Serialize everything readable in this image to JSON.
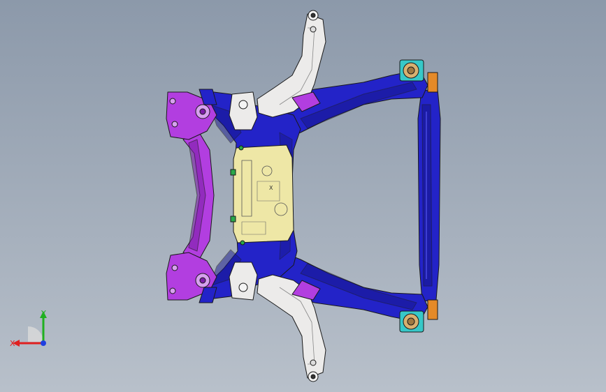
{
  "viewport": {
    "background_top": "#8c99aa",
    "background_bottom": "#b8c0ca"
  },
  "model": {
    "colors": {
      "frame_blue": "#2323c8",
      "frame_dark": "#16168a",
      "bracket_purple": "#b23ee0",
      "bracket_purple_dark": "#7d1fa8",
      "arm_white": "#ecebea",
      "plate_yellow": "#eee7a6",
      "bushing_cyan": "#37c8c8",
      "bushing_orange": "#e58a28",
      "bushing_tan": "#d8b070",
      "mount_green": "#2aa84a",
      "edge": "#1a1a1a"
    },
    "plate_marker": "X"
  },
  "triad": {
    "x_label": "X",
    "y_label": "Y",
    "x_color": "#e02020",
    "y_color": "#20b020",
    "z_color": "#2040e0",
    "icon": "coordinate-triad-icon"
  }
}
